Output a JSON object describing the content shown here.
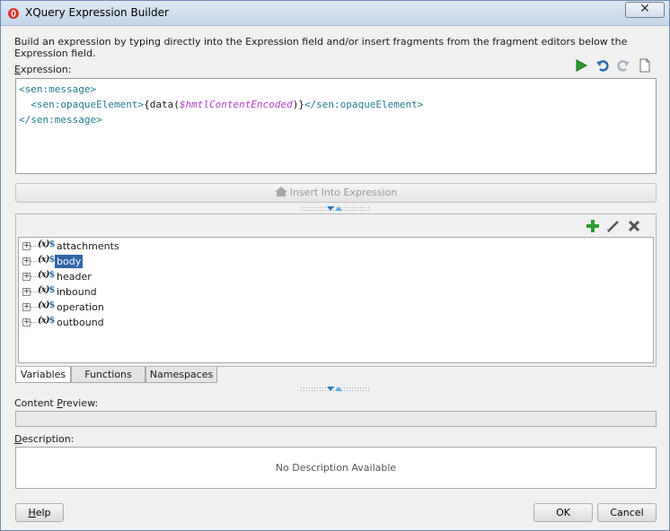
{
  "window": {
    "title": "XQuery Expression Builder",
    "close_glyph": "✕"
  },
  "intro_text": "Build an expression by typing directly into the Expression field and/or insert fragments from the fragment editors below the Expression field.",
  "expression": {
    "label_underlined": "E",
    "label_rest": "xpression:",
    "toolbar": [
      {
        "name": "run-icon",
        "color": "#2e9b2e"
      },
      {
        "name": "undo-icon",
        "color": "#2b6cb0"
      },
      {
        "name": "redo-icon",
        "color": "#a6b4c4"
      },
      {
        "name": "clear-icon",
        "color": "#6b6b6b"
      }
    ],
    "lines": {
      "l1_tag": "<sen:message>",
      "l2_open": "<sen:opaqueElement>",
      "l2_fn": "{data(",
      "l2_var": "$hmtlContentEncoded",
      "l2_fn_close": ")}",
      "l2_close": "</sen:opaqueElement>",
      "l3_tag": "</sen:message>"
    }
  },
  "insert_button": {
    "icon": "home-icon",
    "label": "Insert Into Expression"
  },
  "fragment_toolbar": [
    {
      "name": "add-icon",
      "color": "#2e9b2e"
    },
    {
      "name": "edit-icon",
      "color": "#555555"
    },
    {
      "name": "delete-icon",
      "color": "#555555"
    }
  ],
  "tree": {
    "items": [
      {
        "label": "attachments",
        "selected": false
      },
      {
        "label": "body",
        "selected": true
      },
      {
        "label": "header",
        "selected": false
      },
      {
        "label": "inbound",
        "selected": false
      },
      {
        "label": "operation",
        "selected": false
      },
      {
        "label": "outbound",
        "selected": false
      }
    ],
    "expand_glyph": "+",
    "icon_text": "(x)",
    "icon_suffix": "$"
  },
  "tabs": [
    "Variables",
    "Functions",
    "Namespaces"
  ],
  "content_preview": {
    "label_pre": "Content ",
    "label_underlined": "P",
    "label_post": "review:"
  },
  "description": {
    "label_underlined": "D",
    "label_rest": "escription:",
    "empty_text": "No Description Available"
  },
  "buttons": {
    "help_underlined": "H",
    "help_rest": "elp",
    "ok": "OK",
    "cancel": "Cancel"
  },
  "colors": {
    "tag": "#1e7b8f",
    "variable": "#b03fc4",
    "selection": "#2f64a8"
  }
}
